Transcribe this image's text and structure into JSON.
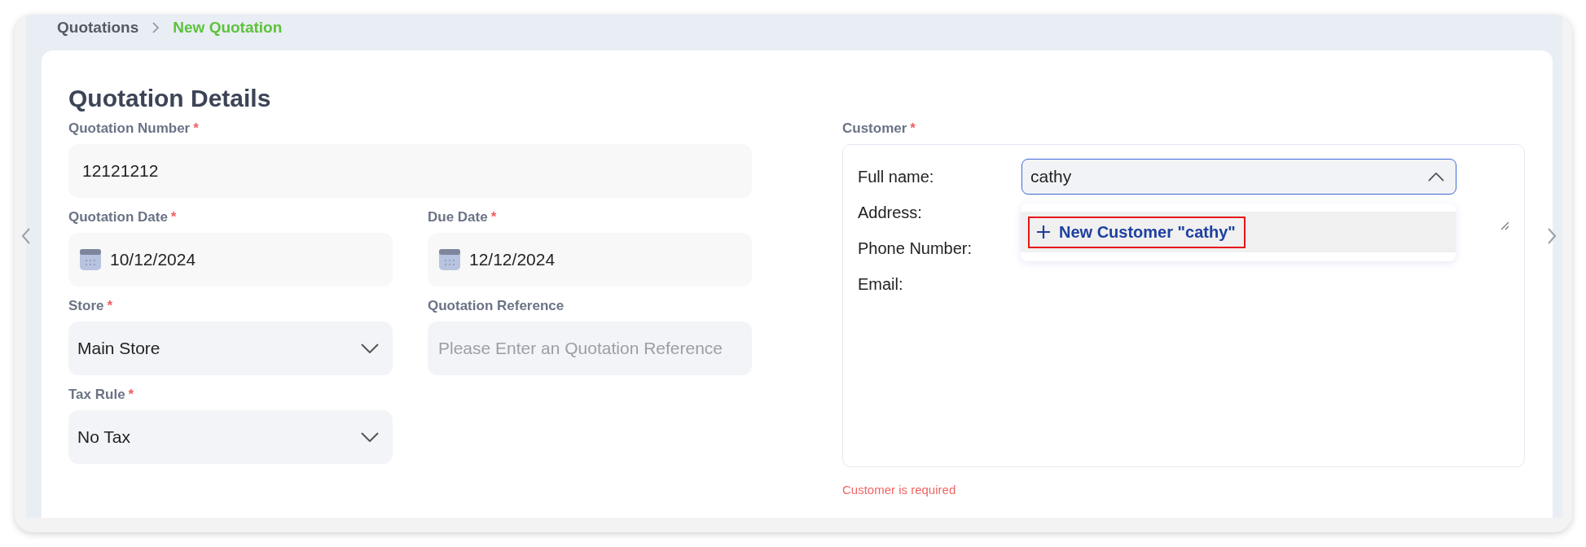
{
  "breadcrumb": [
    {
      "label": "Quotations",
      "current": false
    },
    {
      "label": "New Quotation",
      "current": true
    }
  ],
  "title": "Quotation Details",
  "fields": [
    {
      "kind": "text",
      "label": "Quotation Number",
      "required_mark": "*",
      "value": "12121212",
      "wide": true
    },
    {
      "kind": "date",
      "label": "Quotation Date",
      "required_mark": "*",
      "value": "10/12/2024",
      "wide": false
    },
    {
      "kind": "date",
      "label": "Due Date",
      "required_mark": "*",
      "value": "12/12/2024",
      "wide": false
    },
    {
      "kind": "select",
      "label": "Store",
      "required_mark": "*",
      "value": "Main Store",
      "wide": false
    },
    {
      "kind": "text",
      "label": "Quotation Reference",
      "placeholder": "Please Enter an Quotation Reference",
      "wide": false
    },
    {
      "kind": "select",
      "label": "Tax Rule",
      "required_mark": "*",
      "value": "No Tax",
      "wide": false
    }
  ],
  "customer": {
    "label": "Customer",
    "required_mark": "*",
    "full_name_label": "Full name:",
    "search_value": "cathy",
    "expanded": true,
    "rows": [
      "Address:",
      "Phone Number:",
      "Email:"
    ],
    "options": [
      {
        "label": "New Customer \"cathy\"",
        "highlighted": true
      }
    ],
    "error": "Customer is required"
  }
}
